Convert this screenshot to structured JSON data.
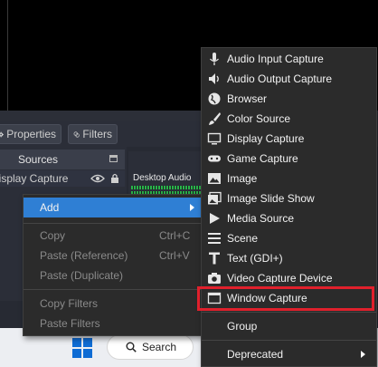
{
  "toolbar": {
    "properties_label": "Properties",
    "filters_label": "Filters"
  },
  "sources": {
    "header": "Sources",
    "row_label": "Display Capture"
  },
  "mixer": {
    "label": "Desktop Audio"
  },
  "context_menu": {
    "add": "Add",
    "copy": "Copy",
    "copy_shortcut": "Ctrl+C",
    "paste_ref": "Paste (Reference)",
    "paste_ref_shortcut": "Ctrl+V",
    "paste_dup": "Paste (Duplicate)",
    "copy_filters": "Copy Filters",
    "paste_filters": "Paste Filters"
  },
  "add_menu": {
    "items": [
      {
        "label": "Audio Input Capture",
        "icon": "microphone-icon"
      },
      {
        "label": "Audio Output Capture",
        "icon": "speaker-icon"
      },
      {
        "label": "Browser",
        "icon": "globe-icon"
      },
      {
        "label": "Color Source",
        "icon": "paintbrush-icon"
      },
      {
        "label": "Display Capture",
        "icon": "monitor-icon"
      },
      {
        "label": "Game Capture",
        "icon": "gamepad-icon"
      },
      {
        "label": "Image",
        "icon": "image-icon"
      },
      {
        "label": "Image Slide Show",
        "icon": "slideshow-icon"
      },
      {
        "label": "Media Source",
        "icon": "play-icon"
      },
      {
        "label": "Scene",
        "icon": "list-icon"
      },
      {
        "label": "Text (GDI+)",
        "icon": "text-icon"
      },
      {
        "label": "Video Capture Device",
        "icon": "camera-icon"
      },
      {
        "label": "Window Capture",
        "icon": "window-icon"
      }
    ],
    "group": "Group",
    "deprecated": "Deprecated"
  },
  "taskbar": {
    "search_label": "Search"
  },
  "colors": {
    "selected": "#2f7fd4",
    "highlight_border": "#e0202c",
    "menu_bg": "#2b2b2b"
  }
}
